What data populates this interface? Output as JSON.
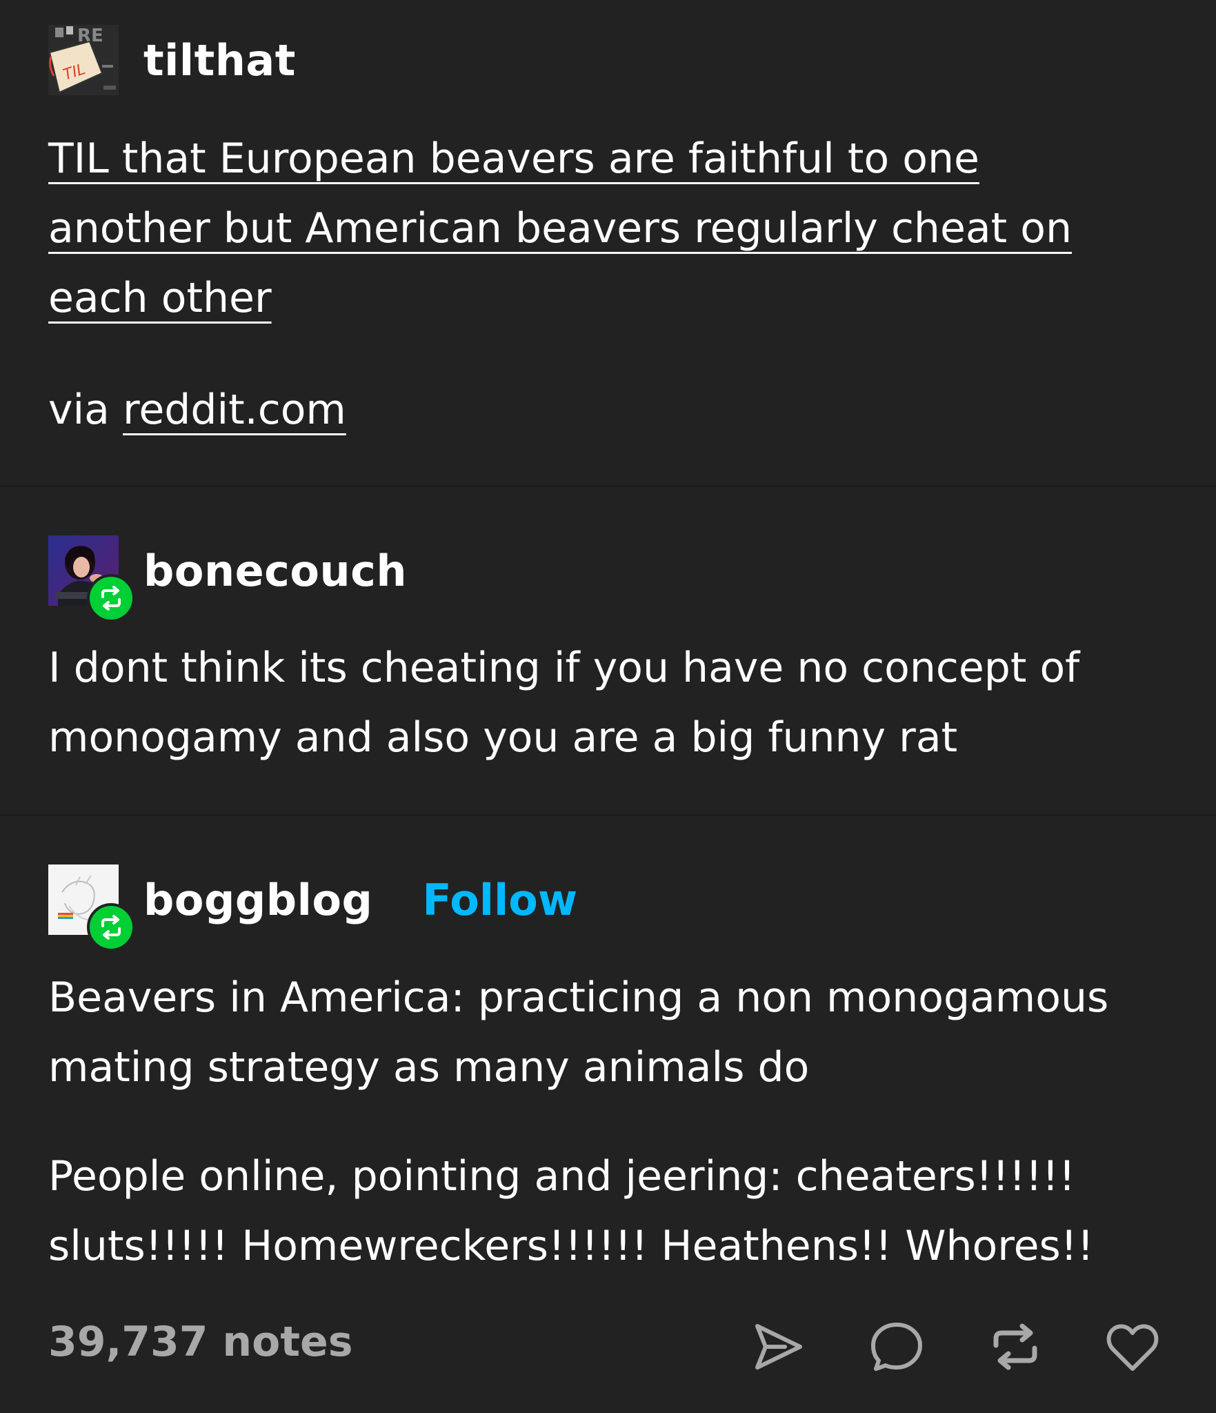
{
  "posts": [
    {
      "username": "tilthat",
      "avatar_icon": "til-logo-icon",
      "title_lines": [
        "TIL that European beavers are faithful to one",
        "another but American beavers regularly cheat on",
        "each other"
      ],
      "via_prefix": "via",
      "via_link": "reddit.com"
    },
    {
      "username": "bonecouch",
      "avatar_icon": "person-portrait-icon",
      "badge_icon": "reblog-icon",
      "lines": [
        "I dont think its cheating if you have no concept of",
        "monogamy and also you are a big funny rat"
      ]
    },
    {
      "username": "boggblog",
      "follow_label": "Follow",
      "avatar_icon": "sketch-avatar-icon",
      "badge_icon": "reblog-icon",
      "lines": [
        "Beavers in America: practicing a non monogamous",
        "mating strategy as many animals do"
      ],
      "lines2": [
        "People online, pointing and jeering: cheaters!!!!!!",
        "sluts!!!!! Homewreckers!!!!!! Heathens!! Whores!!"
      ]
    }
  ],
  "footer": {
    "notes": "39,737 notes",
    "actions": [
      "share-icon",
      "reply-icon",
      "reblog-icon",
      "like-icon"
    ]
  },
  "colors": {
    "background": "#222222",
    "text": "#ffffff",
    "follow": "#00b8ff",
    "reblog_badge": "#00cf35",
    "notes": "#a8a8a8"
  }
}
